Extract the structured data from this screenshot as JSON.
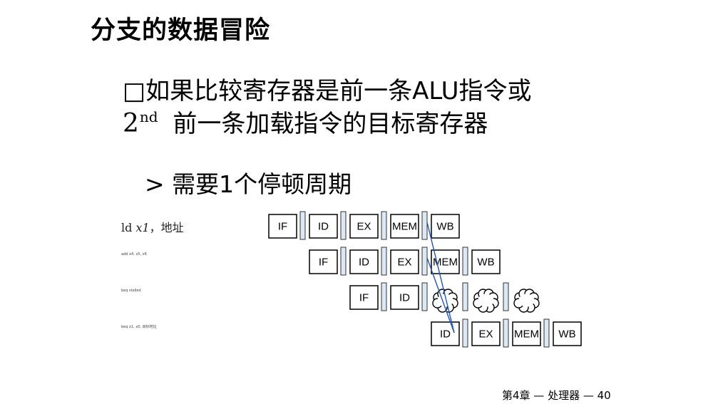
{
  "slide": {
    "title": "分支的数据冒险",
    "bullet": {
      "marker": "□",
      "line1": "如果比较寄存器是前一条ALU指令或",
      "ordinal_base": "2",
      "ordinal_suffix": "nd",
      "line2_text": "前一条加载指令的目标寄存器"
    },
    "sub_bullet": "> 需要1个停顿周期",
    "footer": "第4章 — 处理器 — 40"
  },
  "instructions": {
    "i1": {
      "op": "ld",
      "reg": "x1",
      "rest": "，地址"
    },
    "i2": "add x4, x5, x6",
    "i3": "beq stalled",
    "i4": "beq x1, x0, 目标地址"
  },
  "pipeline": {
    "rows": [
      {
        "stages": [
          "IF",
          "ID",
          "EX",
          "MEM",
          "WB"
        ]
      },
      {
        "stages": [
          "IF",
          "ID",
          "EX",
          "MEM",
          "WB"
        ]
      },
      {
        "stages": [
          "IF",
          "ID",
          "bubble",
          "bubble",
          "bubble"
        ]
      },
      {
        "stages": [
          "ID",
          "EX",
          "MEM",
          "WB"
        ]
      }
    ],
    "colors": {
      "box_stroke": "#000000",
      "register_fill": "#dce9f5",
      "register_stroke": "#333333",
      "forward_line": "#2255bb"
    }
  }
}
